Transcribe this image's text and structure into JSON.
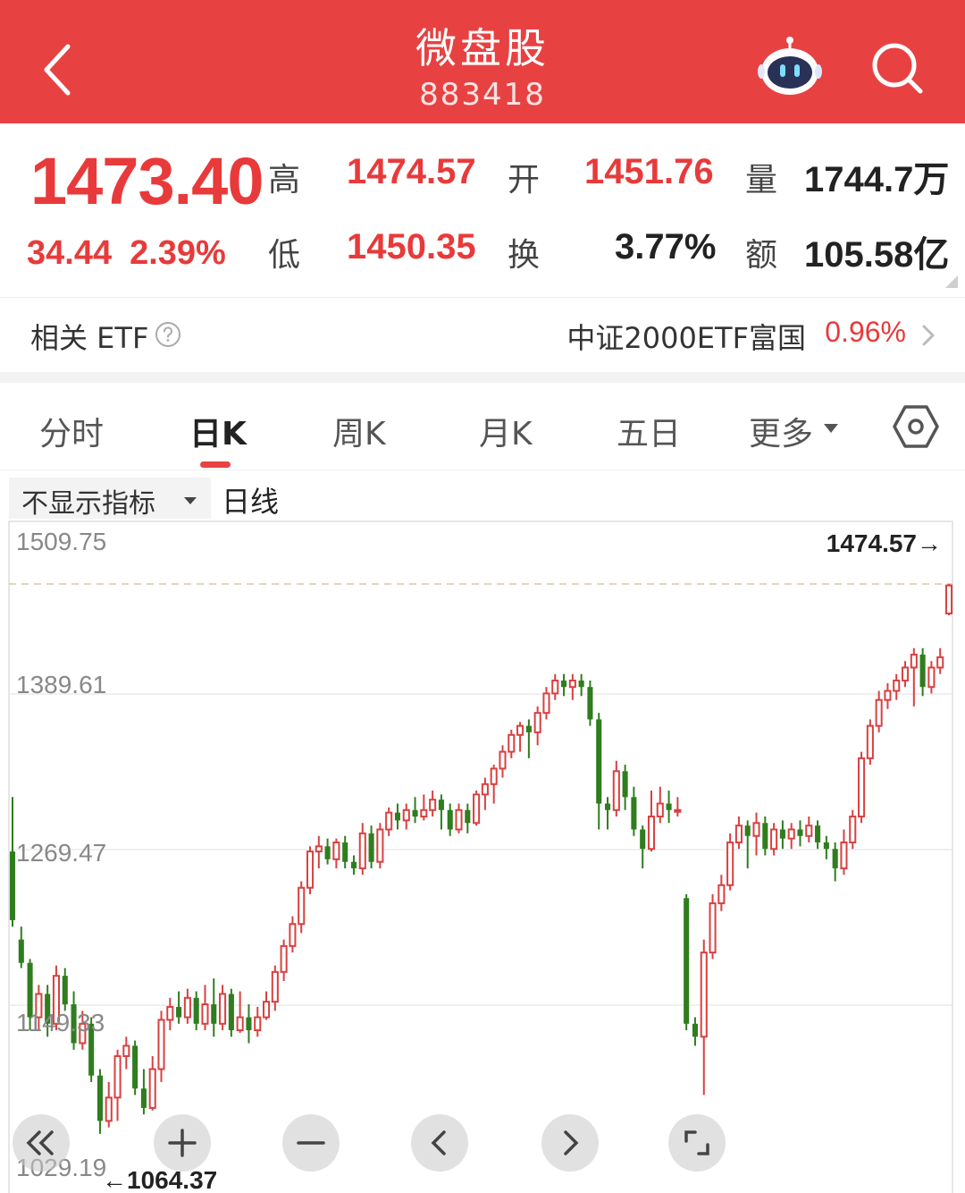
{
  "header": {
    "title": "微盘股",
    "code": "883418"
  },
  "quote": {
    "price": "1473.40",
    "change": "34.44",
    "change_pct": "2.39%",
    "labels": {
      "high": "高",
      "low": "低",
      "open": "开",
      "turnover": "换",
      "volume": "量",
      "amount": "额"
    },
    "values": {
      "high": "1474.57",
      "low": "1450.35",
      "open": "1451.76",
      "turnover": "3.77%",
      "volume": "1744.7万",
      "amount": "105.58亿"
    }
  },
  "etf": {
    "label": "相关 ETF",
    "name": "中证2000ETF富国",
    "pct": "0.96%"
  },
  "tabs": [
    {
      "label": "分时"
    },
    {
      "label": "日K"
    },
    {
      "label": "周K"
    },
    {
      "label": "月K"
    },
    {
      "label": "五日"
    },
    {
      "label": "更多"
    }
  ],
  "indicator": {
    "select_label": "不显示指标",
    "line_label": "日线"
  },
  "chart_data": {
    "type": "candlestick",
    "y_ticks": [
      "1509.75",
      "1389.61",
      "1269.47",
      "1149.33",
      "1029.19"
    ],
    "ylim": [
      1029.19,
      1509.75
    ],
    "high_annotation": "1474.57→",
    "low_annotation": "←1064.37",
    "up_color": "#d94040",
    "down_color": "#2f7d1f",
    "candles": [
      [
        1268,
        1215,
        1310,
        1210
      ],
      [
        1200,
        1182,
        1210,
        1178
      ],
      [
        1182,
        1140,
        1185,
        1130
      ],
      [
        1140,
        1158,
        1165,
        1130
      ],
      [
        1158,
        1135,
        1165,
        1125
      ],
      [
        1135,
        1172,
        1180,
        1130
      ],
      [
        1172,
        1150,
        1178,
        1145
      ],
      [
        1150,
        1120,
        1160,
        1115
      ],
      [
        1120,
        1135,
        1145,
        1115
      ],
      [
        1135,
        1095,
        1140,
        1090
      ],
      [
        1095,
        1060,
        1100,
        1050
      ],
      [
        1060,
        1078,
        1090,
        1055
      ],
      [
        1078,
        1110,
        1115,
        1060
      ],
      [
        1110,
        1118,
        1125,
        1100
      ],
      [
        1118,
        1085,
        1122,
        1080
      ],
      [
        1085,
        1070,
        1100,
        1065
      ],
      [
        1070,
        1100,
        1110,
        1068
      ],
      [
        1100,
        1138,
        1145,
        1090
      ],
      [
        1138,
        1148,
        1155,
        1130
      ],
      [
        1148,
        1140,
        1160,
        1135
      ],
      [
        1140,
        1155,
        1162,
        1135
      ],
      [
        1155,
        1135,
        1160,
        1130
      ],
      [
        1135,
        1150,
        1165,
        1130
      ],
      [
        1150,
        1135,
        1170,
        1125
      ],
      [
        1135,
        1158,
        1165,
        1130
      ],
      [
        1158,
        1130,
        1162,
        1125
      ],
      [
        1130,
        1140,
        1160,
        1128
      ],
      [
        1140,
        1130,
        1150,
        1120
      ],
      [
        1130,
        1140,
        1148,
        1125
      ],
      [
        1140,
        1152,
        1160,
        1138
      ],
      [
        1152,
        1175,
        1180,
        1145
      ],
      [
        1175,
        1195,
        1200,
        1168
      ],
      [
        1195,
        1212,
        1218,
        1190
      ],
      [
        1212,
        1240,
        1245,
        1205
      ],
      [
        1240,
        1268,
        1272,
        1235
      ],
      [
        1268,
        1272,
        1280,
        1255
      ],
      [
        1272,
        1262,
        1278,
        1258
      ],
      [
        1262,
        1275,
        1278,
        1255
      ],
      [
        1275,
        1260,
        1280,
        1255
      ],
      [
        1260,
        1255,
        1265,
        1250
      ],
      [
        1255,
        1282,
        1290,
        1250
      ],
      [
        1282,
        1260,
        1288,
        1255
      ],
      [
        1260,
        1285,
        1290,
        1255
      ],
      [
        1285,
        1298,
        1302,
        1280
      ],
      [
        1298,
        1292,
        1305,
        1285
      ],
      [
        1292,
        1300,
        1305,
        1285
      ],
      [
        1300,
        1295,
        1310,
        1290
      ],
      [
        1295,
        1300,
        1312,
        1292
      ],
      [
        1300,
        1308,
        1315,
        1295
      ],
      [
        1308,
        1300,
        1312,
        1285
      ],
      [
        1300,
        1285,
        1305,
        1280
      ],
      [
        1285,
        1300,
        1305,
        1282
      ],
      [
        1300,
        1290,
        1305,
        1282
      ],
      [
        1290,
        1312,
        1315,
        1288
      ],
      [
        1312,
        1320,
        1325,
        1300
      ],
      [
        1320,
        1332,
        1335,
        1305
      ],
      [
        1332,
        1345,
        1350,
        1325
      ],
      [
        1345,
        1358,
        1362,
        1340
      ],
      [
        1358,
        1365,
        1368,
        1345
      ],
      [
        1365,
        1360,
        1370,
        1340
      ],
      [
        1360,
        1375,
        1380,
        1350
      ],
      [
        1375,
        1390,
        1395,
        1370
      ],
      [
        1390,
        1400,
        1405,
        1385
      ],
      [
        1400,
        1395,
        1405,
        1388
      ],
      [
        1395,
        1400,
        1405,
        1385
      ],
      [
        1400,
        1395,
        1405,
        1388
      ],
      [
        1395,
        1370,
        1400,
        1365
      ],
      [
        1370,
        1305,
        1375,
        1285
      ],
      [
        1305,
        1300,
        1310,
        1285
      ],
      [
        1300,
        1330,
        1338,
        1295
      ],
      [
        1330,
        1310,
        1335,
        1300
      ],
      [
        1310,
        1285,
        1318,
        1280
      ],
      [
        1285,
        1270,
        1288,
        1255
      ],
      [
        1270,
        1295,
        1315,
        1268
      ],
      [
        1295,
        1305,
        1318,
        1290
      ],
      [
        1305,
        1300,
        1315,
        1290
      ],
      [
        1300,
        1300,
        1310,
        1295
      ],
      [
        1232,
        1135,
        1235,
        1130
      ],
      [
        1135,
        1125,
        1140,
        1118
      ],
      [
        1125,
        1190,
        1200,
        1080
      ],
      [
        1190,
        1228,
        1235,
        1185
      ],
      [
        1228,
        1242,
        1250,
        1222
      ],
      [
        1242,
        1275,
        1282,
        1238
      ],
      [
        1275,
        1288,
        1295,
        1270
      ],
      [
        1288,
        1280,
        1292,
        1255
      ],
      [
        1280,
        1290,
        1298,
        1265
      ],
      [
        1290,
        1270,
        1295,
        1265
      ],
      [
        1270,
        1285,
        1290,
        1265
      ],
      [
        1285,
        1278,
        1292,
        1270
      ],
      [
        1278,
        1285,
        1290,
        1270
      ],
      [
        1285,
        1280,
        1292,
        1272
      ],
      [
        1280,
        1288,
        1295,
        1275
      ],
      [
        1288,
        1275,
        1292,
        1270
      ],
      [
        1275,
        1270,
        1280,
        1262
      ],
      [
        1270,
        1255,
        1275,
        1245
      ],
      [
        1255,
        1275,
        1285,
        1250
      ],
      [
        1275,
        1295,
        1300,
        1270
      ],
      [
        1295,
        1340,
        1345,
        1290
      ],
      [
        1340,
        1365,
        1370,
        1335
      ],
      [
        1365,
        1385,
        1392,
        1360
      ],
      [
        1385,
        1392,
        1398,
        1378
      ],
      [
        1392,
        1400,
        1405,
        1385
      ],
      [
        1400,
        1410,
        1415,
        1395
      ],
      [
        1410,
        1420,
        1425,
        1380
      ],
      [
        1420,
        1395,
        1425,
        1388
      ],
      [
        1395,
        1410,
        1415,
        1390
      ],
      [
        1410,
        1418,
        1425,
        1405
      ],
      [
        1451.76,
        1473.4,
        1474.57,
        1450.35
      ]
    ]
  }
}
